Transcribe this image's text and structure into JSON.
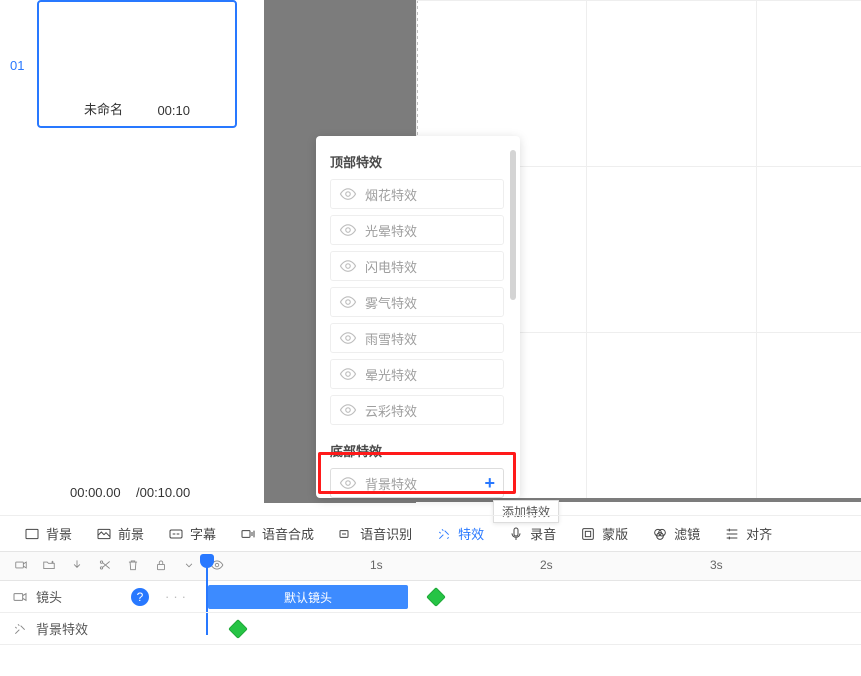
{
  "clip": {
    "number": "01",
    "name": "未命名",
    "duration": "00:10"
  },
  "time": {
    "current": "00:00.00",
    "total": "/00:10.00"
  },
  "panel": {
    "section1_title": "顶部特效",
    "section2_title": "底部特效",
    "top_effects": [
      "烟花特效",
      "光晕特效",
      "闪电特效",
      "雾气特效",
      "雨雪特效",
      "晕光特效",
      "云彩特效"
    ],
    "bottom_effect": "背景特效"
  },
  "tooltip": "添加特效",
  "toolbar": {
    "bg": "背景",
    "fg": "前景",
    "sub": "字幕",
    "tts": "语音合成",
    "asr": "语音识别",
    "fx": "特效",
    "rec": "录音",
    "mask": "蒙版",
    "filter": "滤镜",
    "align": "对齐"
  },
  "ruler": {
    "t1": "1s",
    "t2": "2s",
    "t3": "3s"
  },
  "tracks": {
    "lens": "镜头",
    "lens_clip": "默认镜头",
    "bgfx": "背景特效"
  }
}
